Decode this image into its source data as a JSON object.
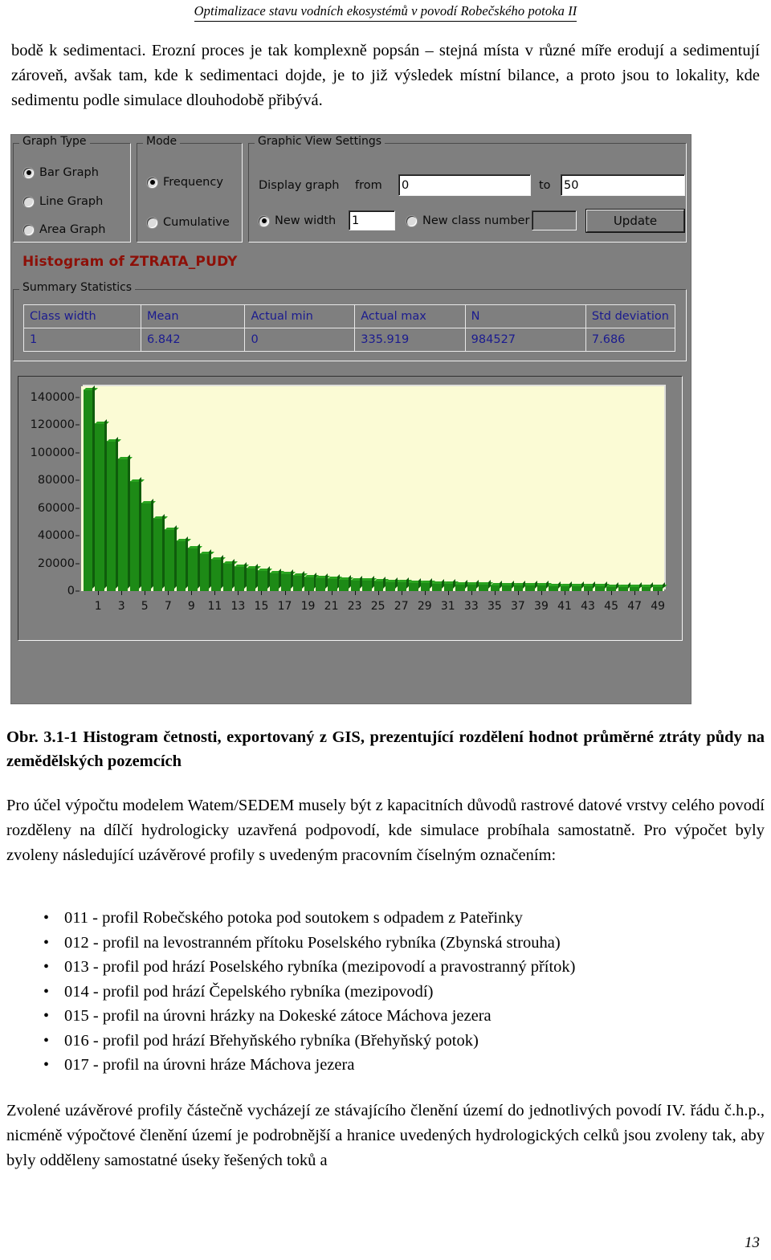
{
  "running_header": "Optimalizace stavu vodních ekosystémů v povodí Robečského potoka II",
  "intro_paragraph": "bodě k sedimentaci. Erozní proces je tak komplexně popsán – stejná místa v různé míře erodují a sedimentují zároveň, avšak tam, kde k sedimentaci dojde, je to již výsledek místní bilance, a proto jsou to lokality, kde sedimentu podle simulace dlouhodobě přibývá.",
  "screenshot": {
    "graph_type": {
      "legend": "Graph Type",
      "options": [
        {
          "label": "Bar Graph",
          "selected": true
        },
        {
          "label": "Line Graph",
          "selected": false
        },
        {
          "label": "Area Graph",
          "selected": false
        }
      ]
    },
    "mode": {
      "legend": "Mode",
      "options": [
        {
          "label": "Frequency",
          "selected": true
        },
        {
          "label": "Cumulative",
          "selected": false
        }
      ]
    },
    "view_settings": {
      "legend": "Graphic View Settings",
      "display_graph_label": "Display graph",
      "from_label": "from",
      "from_value": "0",
      "to_label": "to",
      "to_value": "50",
      "new_width_label": "New width",
      "new_width_selected": true,
      "new_width_value": "1",
      "new_class_number_label": "New class number",
      "new_class_number_selected": false,
      "new_class_number_value": "",
      "update_label": "Update"
    },
    "histogram_title": "Histogram of ZTRATA_PUDY",
    "summary": {
      "legend": "Summary Statistics",
      "headers": [
        "Class width",
        "Mean",
        "Actual min",
        "Actual max",
        "N",
        "Std deviation"
      ],
      "values": [
        "1",
        "6.842",
        "0",
        "335.919",
        "984527",
        "7.686"
      ]
    }
  },
  "chart_data": {
    "type": "bar",
    "title": "Histogram of ZTRATA_PUDY",
    "xlabel": "",
    "ylabel": "",
    "grid": false,
    "legend": "none",
    "ylim": [
      0,
      148000
    ],
    "ytick_labels": [
      "0",
      "20000",
      "40000",
      "60000",
      "80000",
      "100000",
      "120000",
      "140000"
    ],
    "yticks": [
      0,
      20000,
      40000,
      60000,
      80000,
      100000,
      120000,
      140000
    ],
    "xtick_labels": [
      "1",
      "3",
      "5",
      "7",
      "9",
      "11",
      "13",
      "15",
      "17",
      "19",
      "21",
      "23",
      "25",
      "27",
      "29",
      "31",
      "33",
      "35",
      "37",
      "39",
      "41",
      "43",
      "45",
      "47",
      "49"
    ],
    "categories": [
      0,
      1,
      2,
      3,
      4,
      5,
      6,
      7,
      8,
      9,
      10,
      11,
      12,
      13,
      14,
      15,
      16,
      17,
      18,
      19,
      20,
      21,
      22,
      23,
      24,
      25,
      26,
      27,
      28,
      29,
      30,
      31,
      32,
      33,
      34,
      35,
      36,
      37,
      38,
      39,
      40,
      41,
      42,
      43,
      44,
      45,
      46,
      47,
      48,
      49
    ],
    "values": [
      145000,
      121000,
      108000,
      95000,
      79000,
      63000,
      52000,
      44000,
      36000,
      31000,
      26500,
      22500,
      19500,
      17500,
      16000,
      14500,
      13000,
      12000,
      11000,
      10000,
      9300,
      8700,
      8200,
      7700,
      7300,
      6900,
      6500,
      6200,
      5900,
      5600,
      5300,
      5100,
      4900,
      4700,
      4500,
      4300,
      4100,
      4000,
      3900,
      3800,
      3700,
      3600,
      3500,
      3400,
      3300,
      3200,
      3150,
      3100,
      3050,
      3000
    ]
  },
  "figure_caption": "Obr. 3.1-1 Histogram četnosti, exportovaný z GIS, prezentující rozdělení hodnot průměrné ztráty půdy na zemědělských pozemcích",
  "mid_paragraph": "Pro účel výpočtu modelem Watem/SEDEM musely být z kapacitních důvodů rastrové datové vrstvy celého povodí rozděleny na dílčí hydrologicky uzavřená podpovodí, kde simulace probíhala samostatně. Pro výpočet byly zvoleny následující uzávěrové profily s uvedeným pracovním číselným označením:",
  "profiles": [
    "011 - profil Robečského potoka pod soutokem s odpadem z Pateřinky",
    "012 - profil na levostranném přítoku Poselského rybníka (Zbynská strouha)",
    "013 - profil pod hrází Poselského rybníka (mezipovodí a pravostranný přítok)",
    "014 - profil pod hrází Čepelského rybníka (mezipovodí)",
    "015 - profil na úrovni hrázky na Dokeské zátoce Máchova jezera",
    "016 - profil pod hrází Břehyňského rybníka (Břehyňský potok)",
    "017 - profil na úrovni hráze Máchova jezera"
  ],
  "bullet_glyph": "•",
  "end_paragraph": "Zvolené uzávěrové profily částečně vycházejí ze stávajícího členění území do jednotlivých povodí IV. řádu č.h.p., nicméně výpočtové členění území je podrobnější a hranice uvedených hydrologických celků jsou zvoleny tak, aby byly odděleny samostatné úseky řešených toků a",
  "page_number": "13",
  "colors": {
    "bar_green": "#1d8a16",
    "plot_bg": "#fbfbd5",
    "panel_gray": "#7f7f7f",
    "title_red": "#8d1008",
    "stat_blue": "#1b1b8f"
  }
}
